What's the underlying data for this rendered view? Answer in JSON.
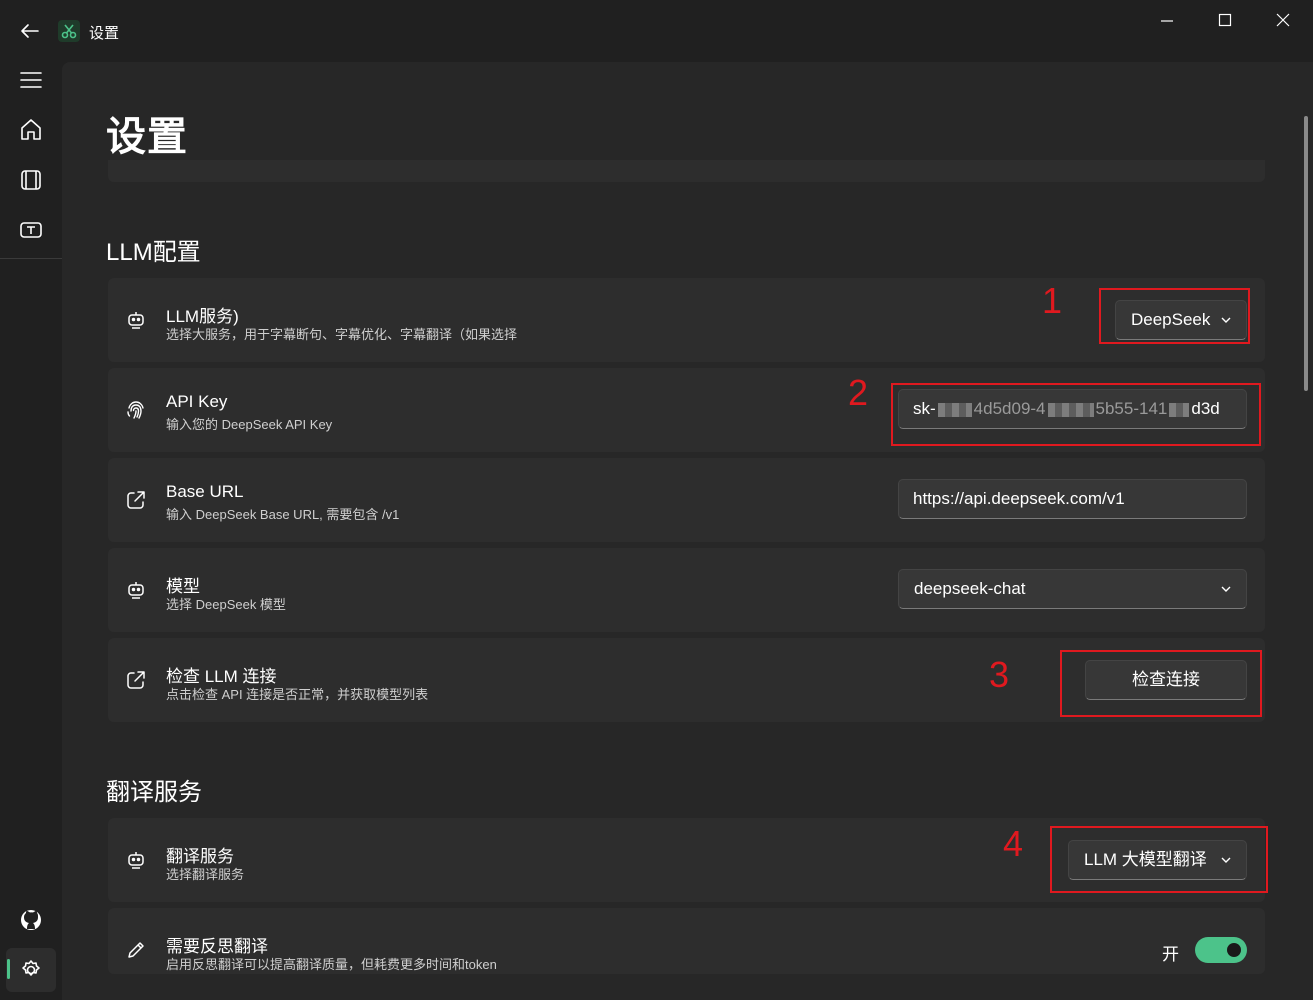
{
  "window": {
    "title": "设置"
  },
  "page": {
    "title": "设置"
  },
  "sections": {
    "llm": {
      "title": "LLM配置"
    },
    "translate": {
      "title": "翻译服务"
    }
  },
  "llm_service": {
    "title": "LLM服务)",
    "desc": "选择大服务，用于字幕断句、字幕优化、字幕翻译（如果选择",
    "value": "DeepSeek"
  },
  "api_key": {
    "title": "API Key",
    "desc": "输入您的 DeepSeek API Key",
    "value_prefix": "sk-",
    "value_mid1": "4d5d09-4",
    "value_mid2": "5b55-141",
    "value_suffix": "d3d"
  },
  "base_url": {
    "title": "Base URL",
    "desc": "输入 DeepSeek Base URL, 需要包含 /v1",
    "value": "https://api.deepseek.com/v1"
  },
  "model": {
    "title": "模型",
    "desc": "选择 DeepSeek 模型",
    "value": "deepseek-chat"
  },
  "check": {
    "title": "检查 LLM 连接",
    "desc": "点击检查 API 连接是否正常，并获取模型列表",
    "button": "检查连接"
  },
  "translate_service": {
    "title": "翻译服务",
    "desc": "选择翻译服务",
    "value": "LLM 大模型翻译"
  },
  "reflect": {
    "title": "需要反思翻译",
    "desc": "启用反思翻译可以提高翻译质量，但耗费更多时间和token",
    "state_label": "开",
    "enabled": true
  },
  "annotations": [
    "1",
    "2",
    "3",
    "4"
  ],
  "colors": {
    "accent": "#4cc38a",
    "annotation": "#e0191f",
    "background": "#202020",
    "card": "#2d2d2d"
  }
}
